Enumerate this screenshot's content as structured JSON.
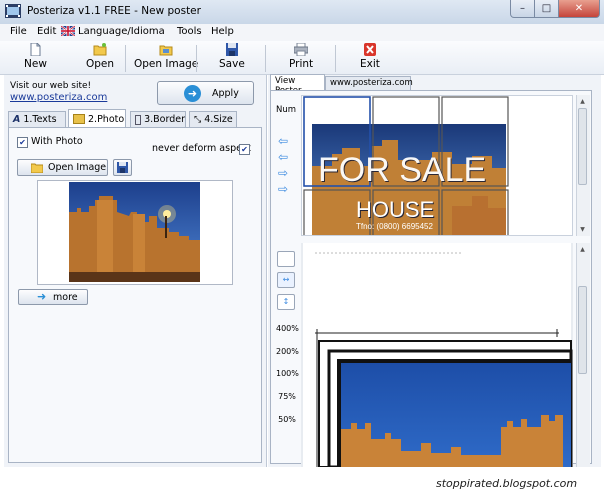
{
  "window": {
    "title": "Posteriza v1.1 FREE - New poster",
    "min_label": "–",
    "max_label": "□",
    "close_label": "✕"
  },
  "menu": {
    "items": [
      "File",
      "Edit",
      "Language/Idioma",
      "Tools",
      "Help"
    ]
  },
  "toolbar": {
    "new": "New",
    "open": "Open",
    "open_image": "Open Image",
    "save": "Save",
    "print": "Print",
    "exit": "Exit"
  },
  "left": {
    "visit_label": "Visit our web site!",
    "site_link": "www.posteriza.com",
    "apply": "Apply",
    "tabs": [
      "1.Texts",
      "2.Photo",
      "3.Border",
      "4.Size"
    ],
    "active_tab": "2.Photo",
    "with_photo": {
      "label": "With Photo",
      "checked": true
    },
    "deform": {
      "label": "never deform aspect",
      "checked": true
    },
    "open_image": "Open Image",
    "more": "more"
  },
  "right": {
    "tabs": [
      "View Poster",
      "www.posteriza.com"
    ],
    "active_tab": "View Poster",
    "num_label": "Num",
    "poster_text": {
      "line1": "FOR SALE",
      "line2": "HOUSE",
      "line3": "Tfno: (0800) 6695452"
    },
    "zoom_levels": [
      "400%",
      "200%",
      "100%",
      "75%",
      "50%"
    ]
  },
  "watermark": "stoppirated.blogspot.com",
  "colors": {
    "titlebar": "#c9d7e8",
    "accent_blue": "#2a8fd6",
    "close_red": "#c5443a",
    "link": "#1a3a9a"
  }
}
